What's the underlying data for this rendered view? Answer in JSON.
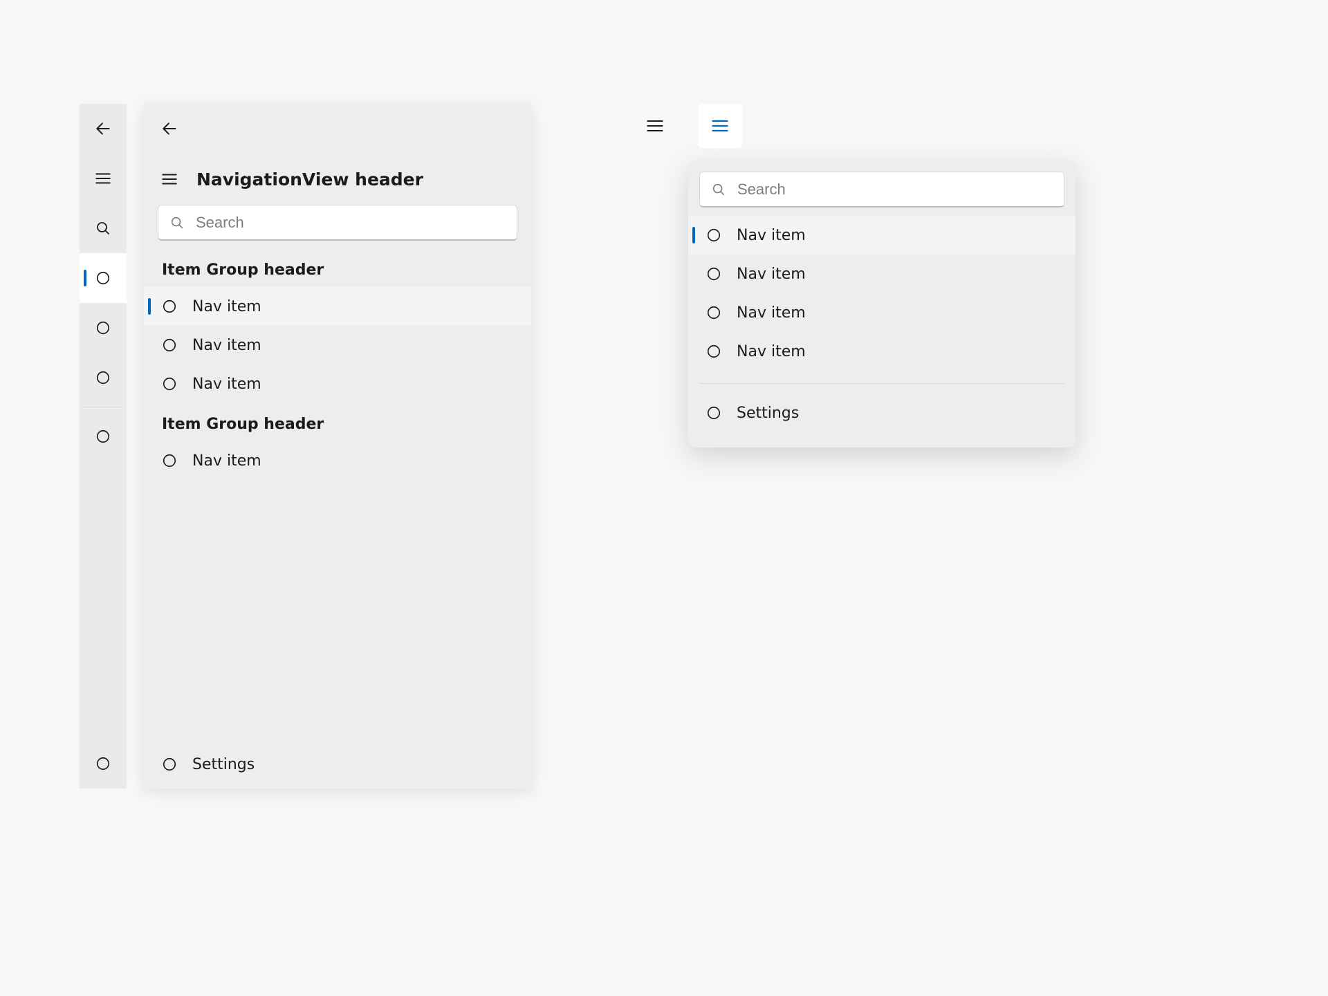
{
  "left": {
    "header": "NavigationView header",
    "search_placeholder": "Search",
    "group_header_1": "Item Group header",
    "nav_item_1": "Nav item",
    "nav_item_2": "Nav item",
    "nav_item_3": "Nav item",
    "group_header_2": "Item Group header",
    "nav_item_4": "Nav item",
    "settings": "Settings"
  },
  "right": {
    "search_placeholder": "Search",
    "nav_item_1": "Nav item",
    "nav_item_2": "Nav item",
    "nav_item_3": "Nav item",
    "nav_item_4": "Nav item",
    "settings": "Settings"
  }
}
